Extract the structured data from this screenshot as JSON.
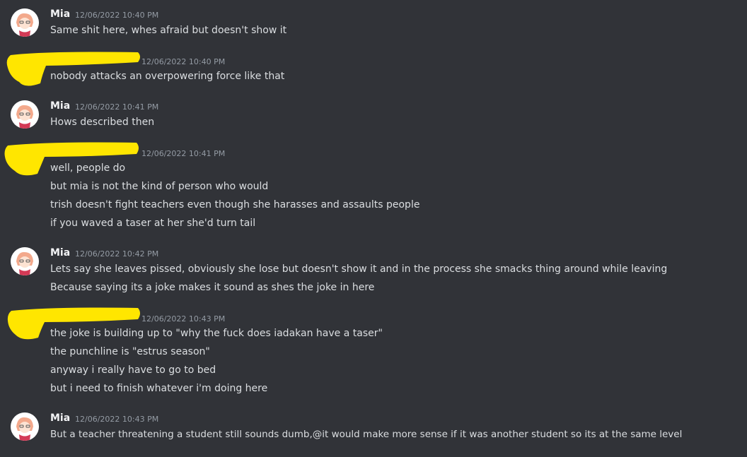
{
  "messages": [
    {
      "author": "Mia",
      "author_redacted": false,
      "timestamp": "12/06/2022 10:40 PM",
      "lines": [
        "Same shit here, whes afraid but doesn't show it"
      ]
    },
    {
      "author": "",
      "author_redacted": true,
      "timestamp": "12/06/2022 10:40 PM",
      "lines": [
        "nobody attacks an overpowering force like that"
      ]
    },
    {
      "author": "Mia",
      "author_redacted": false,
      "timestamp": "12/06/2022 10:41 PM",
      "lines": [
        "Hows described then"
      ]
    },
    {
      "author": "",
      "author_redacted": true,
      "timestamp": "12/06/2022 10:41 PM",
      "lines": [
        "well, people do",
        "but mia is not the kind of person who would",
        "trish doesn't fight teachers even though she harasses and assaults people",
        "if you waved a taser at her she'd turn tail"
      ]
    },
    {
      "author": "Mia",
      "author_redacted": false,
      "timestamp": "12/06/2022 10:42 PM",
      "lines": [
        "Lets say she leaves pissed, obviously she lose but doesn't show it and in the process she smacks thing around while leaving",
        "Because saying its a joke makes it sound as shes the joke in here"
      ]
    },
    {
      "author": "",
      "author_redacted": true,
      "timestamp": "12/06/2022 10:43 PM",
      "lines": [
        "the joke is building up to \"why the fuck does iadakan have a taser\"",
        "the punchline is \"estrus season\"",
        "anyway i really have to go to bed",
        "but i need to finish whatever i'm doing here"
      ]
    },
    {
      "author": "Mia",
      "author_redacted": false,
      "timestamp": "12/06/2022 10:43 PM",
      "lines": [
        "But a teacher threatening a student still sounds dumb,@it would make more sense if it was another student so its at the same level"
      ]
    }
  ],
  "colors": {
    "background": "#313338",
    "username": "#f2f3f5",
    "timestamp": "#949ba4",
    "message_text": "#dbdee1",
    "redaction_marker": "#ffe600"
  },
  "icons": {
    "mia_avatar": "anime-character-avatar-icon"
  }
}
